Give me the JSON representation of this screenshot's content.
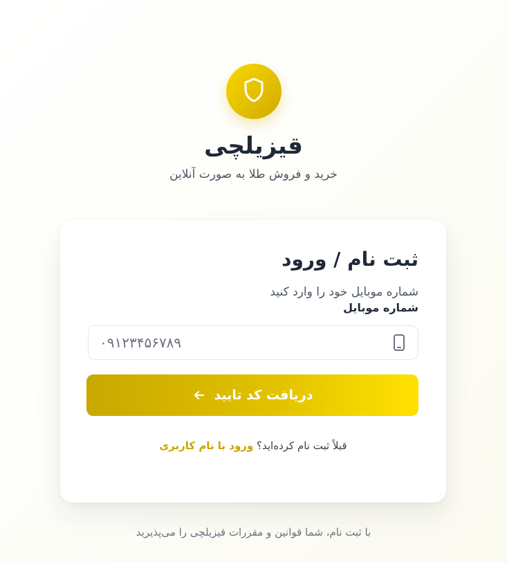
{
  "brand": {
    "logo_icon": "shield-icon",
    "name": "قیزیلچی",
    "tagline": "خرید و فروش طلا به صورت آنلاین",
    "accent_color": "#e3c000"
  },
  "form": {
    "title": "ثبت نام / ورود",
    "subtitle": "شماره موبایل خود را وارد کنید",
    "mobile_label": "شماره موبایل",
    "mobile_placeholder": "۰۹۱۲۳۴۵۶۷۸۹",
    "mobile_value": "",
    "mobile_icon": "mobile-phone-icon",
    "submit_label": "دریافت کد تایید",
    "submit_icon": "arrow-icon",
    "already_registered_text": "قبلاً ثبت نام کرده‌اید؟",
    "login_link_label": "ورود با نام کاربری"
  },
  "footer": {
    "terms_text": "با ثبت نام، شما قوانین و مقررات قیزیلچی را می‌پذیرید"
  }
}
